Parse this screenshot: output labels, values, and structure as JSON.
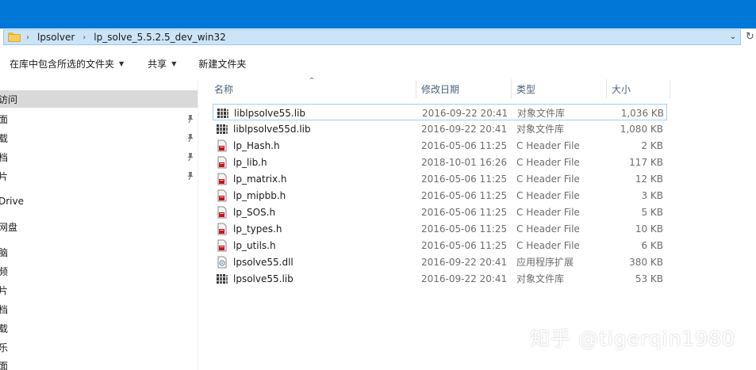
{
  "colors": {
    "title_bar": "#0078d7",
    "address_bg": "#cce4f7",
    "selected_nav": "#d9d9d9",
    "focus_border": "#99d1ff"
  },
  "address_bar": {
    "segments": [
      "lpsolver",
      "lp_solve_5.5.2.5_dev_win32"
    ]
  },
  "toolbar": {
    "include_in_library": "在库中包含所选的文件夹",
    "share": "共享",
    "new_folder": "新建文件夹"
  },
  "nav": {
    "items": [
      {
        "label": "访问",
        "pinned": false,
        "selected": true
      },
      {
        "label": "面",
        "pinned": true
      },
      {
        "label": "载",
        "pinned": true
      },
      {
        "label": "档",
        "pinned": true
      },
      {
        "label": "片",
        "pinned": true
      },
      {
        "label": "Drive",
        "pinned": false
      },
      {
        "label": "网盘",
        "pinned": false
      },
      {
        "label": "脑",
        "pinned": false
      },
      {
        "label": "频",
        "pinned": false
      },
      {
        "label": "片",
        "pinned": false
      },
      {
        "label": "档",
        "pinned": false
      },
      {
        "label": "载",
        "pinned": false
      },
      {
        "label": "乐",
        "pinned": false
      },
      {
        "label": "面",
        "pinned": false
      }
    ]
  },
  "columns": {
    "name": "名称",
    "date": "修改日期",
    "type": "类型",
    "size": "大小"
  },
  "files": [
    {
      "name": "liblpsolve55.lib",
      "date": "2016-09-22 20:41",
      "type": "对象文件库",
      "size": "1,036 KB",
      "icon": "lib-file-icon"
    },
    {
      "name": "liblpsolve55d.lib",
      "date": "2016-09-22 20:41",
      "type": "对象文件库",
      "size": "1,080 KB",
      "icon": "lib-file-icon"
    },
    {
      "name": "lp_Hash.h",
      "date": "2016-05-06 11:25",
      "type": "C Header File",
      "size": "2 KB",
      "icon": "header-file-icon"
    },
    {
      "name": "lp_lib.h",
      "date": "2018-10-01 16:26",
      "type": "C Header File",
      "size": "117 KB",
      "icon": "header-file-icon"
    },
    {
      "name": "lp_matrix.h",
      "date": "2016-05-06 11:25",
      "type": "C Header File",
      "size": "12 KB",
      "icon": "header-file-icon"
    },
    {
      "name": "lp_mipbb.h",
      "date": "2016-05-06 11:25",
      "type": "C Header File",
      "size": "3 KB",
      "icon": "header-file-icon"
    },
    {
      "name": "lp_SOS.h",
      "date": "2016-05-06 11:25",
      "type": "C Header File",
      "size": "5 KB",
      "icon": "header-file-icon"
    },
    {
      "name": "lp_types.h",
      "date": "2016-05-06 11:25",
      "type": "C Header File",
      "size": "10 KB",
      "icon": "header-file-icon"
    },
    {
      "name": "lp_utils.h",
      "date": "2016-05-06 11:25",
      "type": "C Header File",
      "size": "6 KB",
      "icon": "header-file-icon"
    },
    {
      "name": "lpsolve55.dll",
      "date": "2016-09-22 20:41",
      "type": "应用程序扩展",
      "size": "380 KB",
      "icon": "dll-file-icon"
    },
    {
      "name": "lpsolve55.lib",
      "date": "2016-09-22 20:41",
      "type": "对象文件库",
      "size": "53 KB",
      "icon": "lib-file-icon"
    }
  ],
  "watermark": "知乎 @tigerqin1980"
}
